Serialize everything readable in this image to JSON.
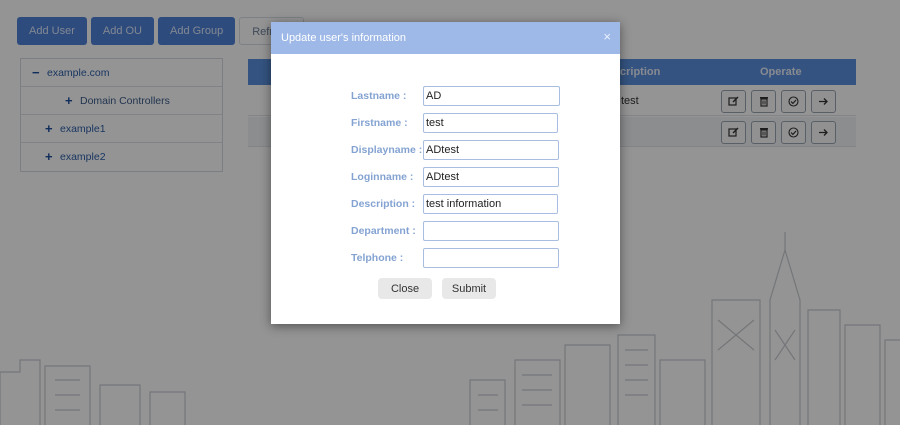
{
  "toolbar": {
    "buttons": [
      "Add User",
      "Add OU",
      "Add Group",
      "Refresh"
    ]
  },
  "tree": {
    "root": "example.com",
    "sub": "Domain Controllers",
    "children": [
      "example1",
      "example2"
    ]
  },
  "table": {
    "headers": {
      "description": "cription",
      "operate": "Operate"
    },
    "rows": [
      {
        "description": "test"
      }
    ],
    "op_icons": [
      "edit-icon",
      "trash-icon",
      "check-circle-icon",
      "arrow-right-icon"
    ]
  },
  "modal": {
    "title": "Update user's information",
    "close_symbol": "×",
    "fields": [
      {
        "label": "Lastname  :",
        "value": "AD"
      },
      {
        "label": "Firstname  :",
        "value": "test"
      },
      {
        "label": "Displayname :",
        "value": "ADtest"
      },
      {
        "label": "Loginname  :",
        "value": "ADtest"
      },
      {
        "label": "Description :",
        "value": "test information"
      },
      {
        "label": "Department  :",
        "value": ""
      },
      {
        "label": "Telphone  :",
        "value": ""
      }
    ],
    "close_label": "Close",
    "submit_label": "Submit"
  },
  "colors": {
    "accent": "#4f82d8",
    "modal_header": "#9eb9e8",
    "label": "#84a3d2"
  }
}
